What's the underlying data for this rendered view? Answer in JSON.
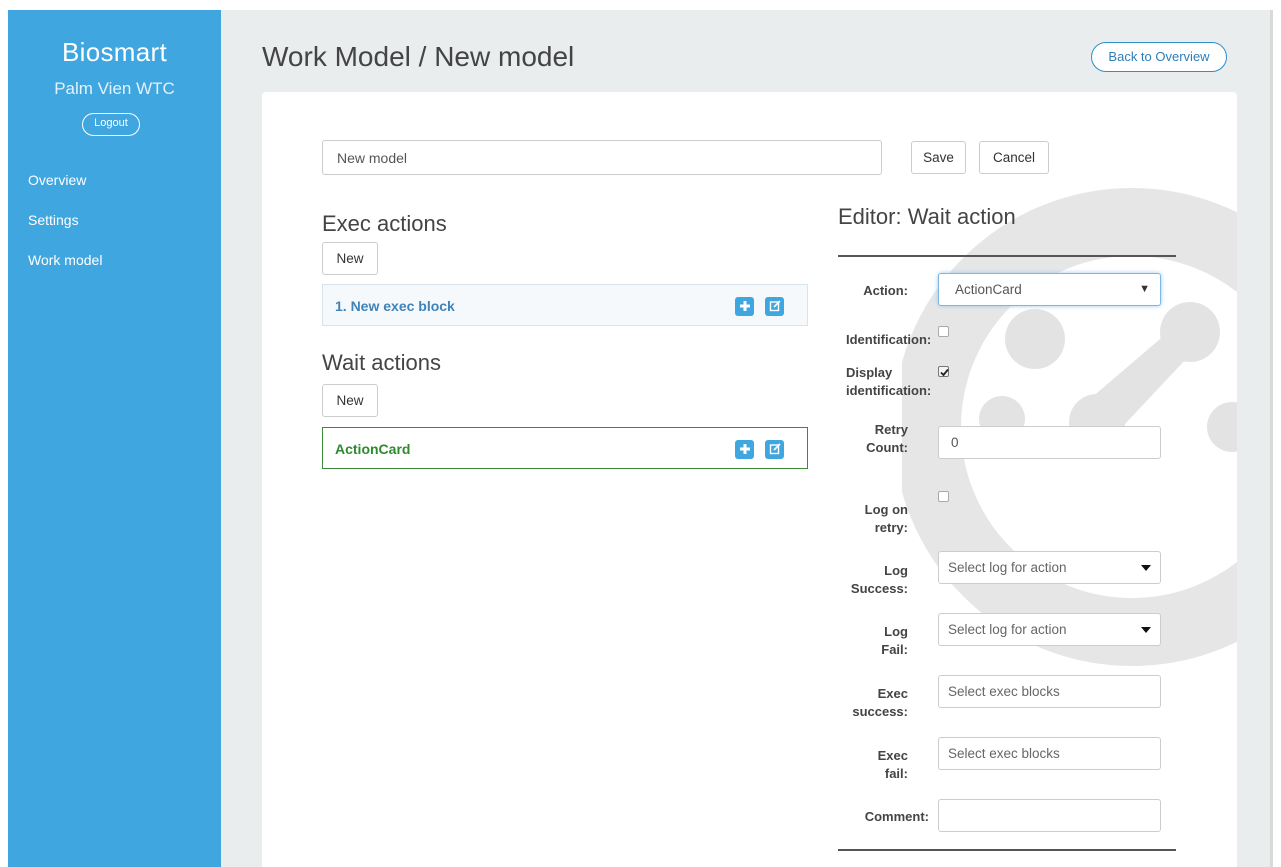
{
  "sidebar": {
    "brand": "Biosmart",
    "site": "Palm Vien WTC",
    "logout_label": "Logout",
    "items": [
      {
        "label": "Overview"
      },
      {
        "label": "Settings"
      },
      {
        "label": "Work model"
      }
    ]
  },
  "header": {
    "title": "Work Model / New model",
    "back_label": "Back to Overview"
  },
  "model": {
    "name_value": "New model",
    "save_label": "Save",
    "cancel_label": "Cancel"
  },
  "exec_actions": {
    "title": "Exec actions",
    "new_label": "New",
    "items": [
      {
        "label": "1. New exec block"
      }
    ]
  },
  "wait_actions": {
    "title": "Wait actions",
    "new_label": "New",
    "items": [
      {
        "label": "ActionCard"
      }
    ]
  },
  "editor": {
    "title": "Editor: Wait action",
    "action_label": "Action:",
    "action_value": "ActionCard",
    "identification_label": "Identification:",
    "identification_checked": false,
    "display_identification_label_1": "Display",
    "display_identification_label_2": "identification:",
    "display_identification_checked": true,
    "retry_label_1": "Retry",
    "retry_label_2": "Count:",
    "retry_value": "0",
    "log_retry_label_1": "Log on",
    "log_retry_label_2": "retry:",
    "log_retry_checked": false,
    "log_success_label_1": "Log",
    "log_success_label_2": "Success:",
    "log_success_placeholder": "Select log for action",
    "log_fail_label_1": "Log",
    "log_fail_label_2": "Fail:",
    "log_fail_placeholder": "Select log for action",
    "exec_success_label_1": "Exec",
    "exec_success_label_2": "success:",
    "exec_success_placeholder": "Select exec blocks",
    "exec_fail_label_1": "Exec",
    "exec_fail_label_2": "fail:",
    "exec_fail_placeholder": "Select exec blocks",
    "comment_label": "Comment:",
    "comment_value": ""
  },
  "icons": {
    "add": "plus-icon",
    "edit": "edit-icon",
    "watermark": "gauge-logo-watermark"
  },
  "colors": {
    "sidebar": "#3fa6e0",
    "accent": "#2d8fcc",
    "active_item": "#2e8a2e",
    "background": "#eaeded"
  }
}
